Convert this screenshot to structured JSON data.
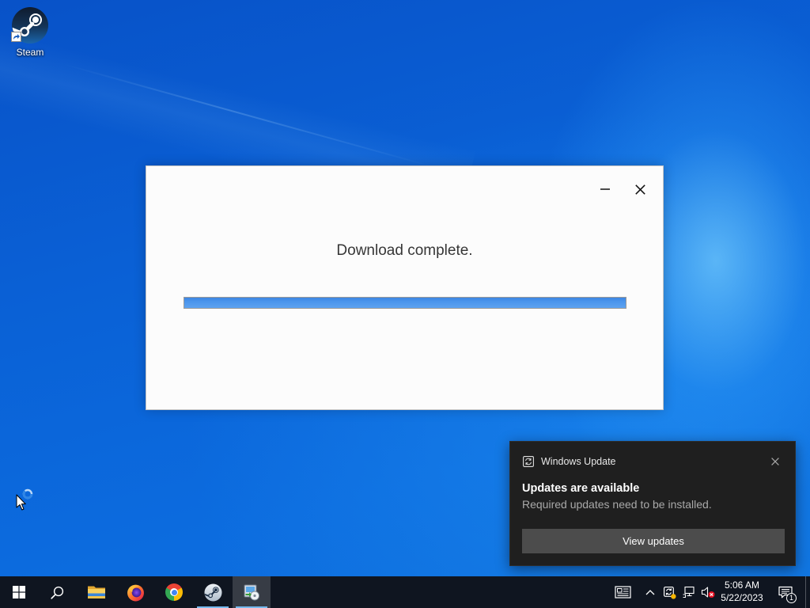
{
  "colors": {
    "wallpaper": "#0b63d8",
    "taskbar": "#0f1520",
    "accent": "#76b9ed",
    "toast_background": "#1f1f1f",
    "toast_button": "#4c4c4c",
    "progress_fill": "#4a94ec"
  },
  "desktop": {
    "icons": [
      {
        "label": "Steam",
        "icon": "steam-icon",
        "shortcut": true
      }
    ]
  },
  "dialog": {
    "message": "Download complete.",
    "progress_percent": 100,
    "controls": [
      {
        "icon": "minimize-icon"
      },
      {
        "icon": "close-icon"
      }
    ]
  },
  "toast": {
    "app_icon": "windows-update-icon",
    "app_name": "Windows Update",
    "title": "Updates are available",
    "body": "Required updates need to be installed.",
    "button_label": "View updates",
    "close_icon": "close-icon"
  },
  "taskbar": {
    "apps": [
      {
        "icon": "windows-logo-icon",
        "running": false,
        "active": false
      },
      {
        "icon": "search-icon",
        "running": false,
        "active": false
      },
      {
        "icon": "file-explorer-icon",
        "running": false,
        "active": false
      },
      {
        "icon": "firefox-icon",
        "running": false,
        "active": false
      },
      {
        "icon": "chrome-icon",
        "running": false,
        "active": false
      },
      {
        "icon": "steam-icon",
        "running": true,
        "active": false
      },
      {
        "icon": "installer-icon",
        "running": true,
        "active": true
      }
    ],
    "tray": {
      "icons": [
        "news-icon",
        "chevron-up-icon",
        "windows-update-tray-icon",
        "network-icon",
        "volume-muted-icon",
        "notification-icon"
      ],
      "time": "5:06 AM",
      "date": "5/22/2023",
      "notification_count": "1"
    }
  },
  "cursor": {
    "icon": "busy-cursor-icon"
  }
}
